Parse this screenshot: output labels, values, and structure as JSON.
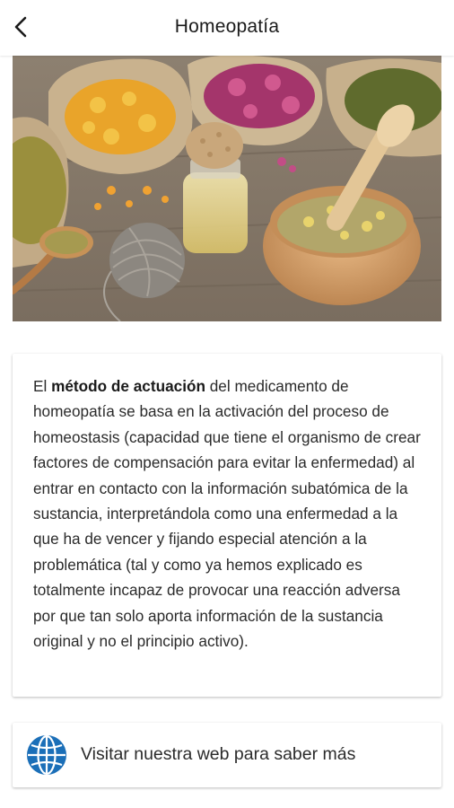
{
  "header": {
    "title": "Homeopatía",
    "back_icon": "chevron-left-icon"
  },
  "hero_image": {
    "description_icon": "herbs-photo"
  },
  "info_card": {
    "text_start": "El ",
    "text_bold": "método de actuación",
    "text_rest": " del medicamento de homeopatía se basa en la activación del proceso de homeostasis (capacidad que tiene el organismo de crear factores de compensación para evitar la enfermedad)  al entrar en contacto con la información subatómica de la sustancia, interpretándola como una enfermedad a la que ha de vencer y fijando especial atención a la problemática  (tal y como ya hemos explicado es totalmente incapaz de provocar una reacción adversa por que tan solo aporta información de la sustancia original y no el principio activo)."
  },
  "link_card": {
    "icon": "globe-icon",
    "label": "Visitar nuestra web para saber más"
  },
  "colors": {
    "globe_blue": "#1b6fb8",
    "card_bg": "#ffffff",
    "text": "#2b2b2b"
  }
}
